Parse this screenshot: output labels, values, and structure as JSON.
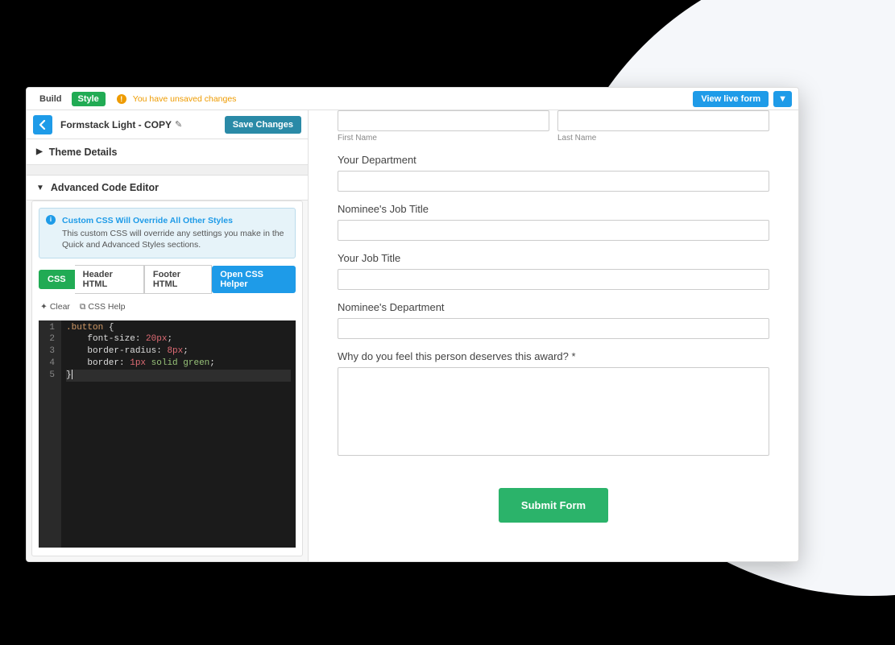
{
  "top": {
    "build": "Build",
    "style": "Style",
    "warning": "You have unsaved changes",
    "view_live": "View live form",
    "dropdown_glyph": "▼"
  },
  "panel": {
    "title": "Formstack Light - COPY",
    "save": "Save Changes",
    "theme_details": "Theme Details",
    "advanced": "Advanced Code Editor"
  },
  "info": {
    "title": "Custom CSS Will Override All Other Styles",
    "body": "This custom CSS will override any settings you make in the Quick and Advanced Styles sections."
  },
  "tabs": {
    "css": "CSS",
    "header": "Header HTML",
    "footer": "Footer HTML",
    "open_helper": "Open CSS Helper"
  },
  "tools": {
    "clear": "Clear",
    "help": "CSS Help"
  },
  "code": {
    "l1a": ".button",
    "l1b": " {",
    "l2a": "font-size",
    "l2b": ": ",
    "l2c": "20",
    "l2d": "px",
    "l2e": ";",
    "l3a": "border-radius",
    "l3b": ": ",
    "l3c": "8",
    "l3d": "px",
    "l3e": ";",
    "l4a": "border",
    "l4b": ": ",
    "l4c": "1",
    "l4d": "px",
    "l4e": " ",
    "l4f": "solid",
    "l4g": " ",
    "l4h": "green",
    "l4i": ";",
    "l5": "}",
    "n1": "1",
    "n2": "2",
    "n3": "3",
    "n4": "4",
    "n5": "5"
  },
  "form": {
    "first_name_sub": "First Name",
    "last_name_sub": "Last Name",
    "your_department": "Your Department",
    "nominee_job_title": "Nominee's Job Title",
    "your_job_title": "Your Job Title",
    "nominee_department": "Nominee's Department",
    "why_award": "Why do you feel this person deserves this award? *",
    "submit": "Submit Form"
  }
}
